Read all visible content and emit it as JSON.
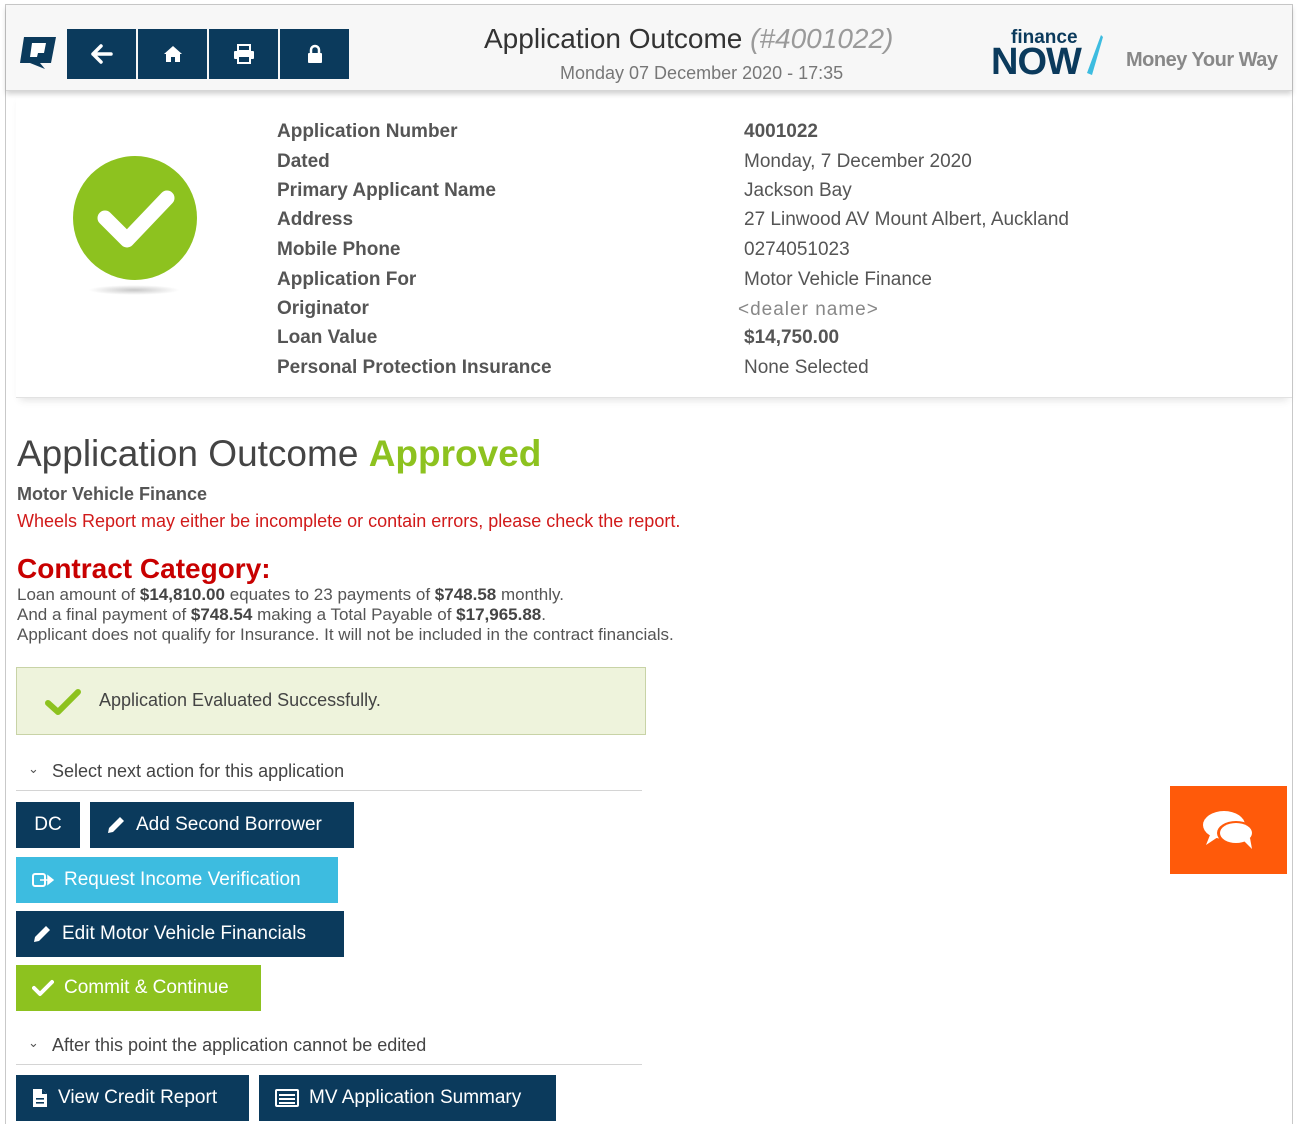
{
  "header": {
    "title": "Application Outcome",
    "title_number": "(#4001022)",
    "datetime": "Monday 07 December 2020 - 17:35",
    "brand_small": "finance",
    "brand_big": "NOW",
    "tagline": "Money Your Way",
    "nav_icons": [
      "back-arrow-icon",
      "home-icon",
      "print-icon",
      "lock-icon"
    ]
  },
  "summary": {
    "rows": [
      {
        "label": "Application Number",
        "value": "4001022"
      },
      {
        "label": "Dated",
        "value": "Monday, 7 December 2020"
      },
      {
        "label": "Primary Applicant Name",
        "value": "Jackson Bay"
      },
      {
        "label": "Address",
        "value": "27 Linwood AV Mount Albert, Auckland"
      },
      {
        "label": "Mobile Phone",
        "value": "0274051023"
      },
      {
        "label": "Application For",
        "value": "Motor Vehicle Finance"
      },
      {
        "label": "Originator",
        "value": "<dealer name>"
      },
      {
        "label": "Loan Value",
        "value": "$14,750.00"
      },
      {
        "label": "Personal Protection Insurance",
        "value": "None Selected"
      }
    ]
  },
  "outcome": {
    "title": "Application Outcome",
    "status": "Approved",
    "product": "Motor Vehicle Finance",
    "warning": "Wheels Report may either be incomplete or contain errors, please check the report."
  },
  "contract": {
    "title": "Contract Category:",
    "line1": {
      "a": "Loan amount of ",
      "amount": "$14,810.00",
      "b": " equates to 23 payments of ",
      "payment": "$748.58",
      "c": " monthly."
    },
    "line2": {
      "a": "And a final payment of ",
      "final": "$748.54",
      "b": " making a Total Payable of ",
      "total": "$17,965.88",
      "c": "."
    },
    "line3": "Applicant does not qualify for Insurance. It will not be included in the contract financials."
  },
  "evaluation": {
    "message": "Application Evaluated Successfully."
  },
  "actions": {
    "section1": "Select next action for this application",
    "dc": "DC",
    "add_second_borrower": "Add Second Borrower",
    "request_income_verification": "Request Income Verification",
    "edit_mv_financials": "Edit Motor Vehicle Financials",
    "commit_continue": "Commit & Continue",
    "section2": "After this point the application cannot be edited",
    "view_credit_report": "View Credit Report",
    "mv_application_summary": "MV Application Summary"
  },
  "colors": {
    "navy": "#0b3a5c",
    "sky": "#3dbce0",
    "lime": "#8dc21f",
    "warning_red": "#d11a1a",
    "chat_orange": "#ff5a0a"
  }
}
